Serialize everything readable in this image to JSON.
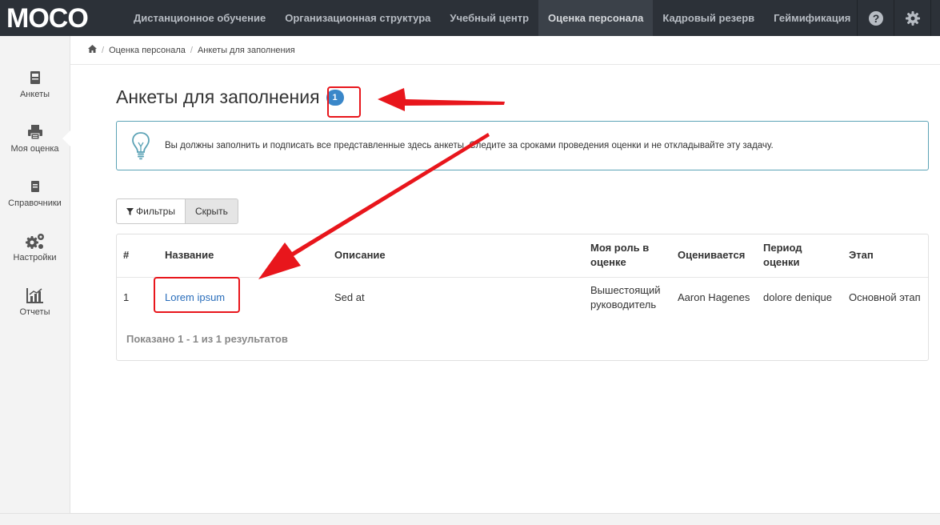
{
  "brand": {
    "logo_text": "MOCO"
  },
  "nav": {
    "items": [
      {
        "label": "Дистанционное обучение",
        "active": false
      },
      {
        "label": "Организационная структура",
        "active": false
      },
      {
        "label": "Учебный центр",
        "active": false
      },
      {
        "label": "Оценка персонала",
        "active": true
      },
      {
        "label": "Кадровый резерв",
        "active": false
      },
      {
        "label": "Геймификация",
        "active": false
      }
    ],
    "help_icon": "question-circle-icon",
    "settings_icon": "gear-icon"
  },
  "sidebar": {
    "items": [
      {
        "label": "Анкеты",
        "icon": "book-icon",
        "active": false
      },
      {
        "label": "Моя оценка",
        "icon": "printer-icon",
        "active": true
      },
      {
        "label": "Справочники",
        "icon": "notebook-icon",
        "active": false
      },
      {
        "label": "Настройки",
        "icon": "gears-icon",
        "active": false
      },
      {
        "label": "Отчеты",
        "icon": "chart-icon",
        "active": false
      }
    ]
  },
  "breadcrumb": {
    "home_icon": "home-icon",
    "items": [
      "Оценка персонала",
      "Анкеты для заполнения"
    ]
  },
  "page": {
    "title": "Анкеты для заполнения",
    "count_badge": "1"
  },
  "alert": {
    "icon": "lightbulb-icon",
    "text": "Вы должны заполнить и подписать все представленные здесь анкеты. Следите за сроками проведения оценки и не откладывайте эту задачу."
  },
  "filters": {
    "filter_label": "Фильтры",
    "hide_label": "Скрыть"
  },
  "table": {
    "headers": {
      "num": "#",
      "name": "Название",
      "description": "Описание",
      "role_line1": "Моя роль в",
      "role_line2": "оценке",
      "evaluated": "Оценивается",
      "period_line1": "Период",
      "period_line2": "оценки",
      "stage": "Этап"
    },
    "rows": [
      {
        "num": "1",
        "name": "Lorem ipsum",
        "description": "Sed at",
        "role_line1": "Вышестоящий",
        "role_line2": "руководитель",
        "evaluated": "Aaron Hagenes",
        "period": "dolore denique",
        "stage": "Основной этап"
      }
    ],
    "summary": "Показано 1 - 1 из 1 результатов"
  },
  "colors": {
    "navbar_bg": "#2c3138",
    "accent_blue": "#3a87c9",
    "annotation_red": "#e8161c",
    "alert_border": "#5ca3b6"
  }
}
